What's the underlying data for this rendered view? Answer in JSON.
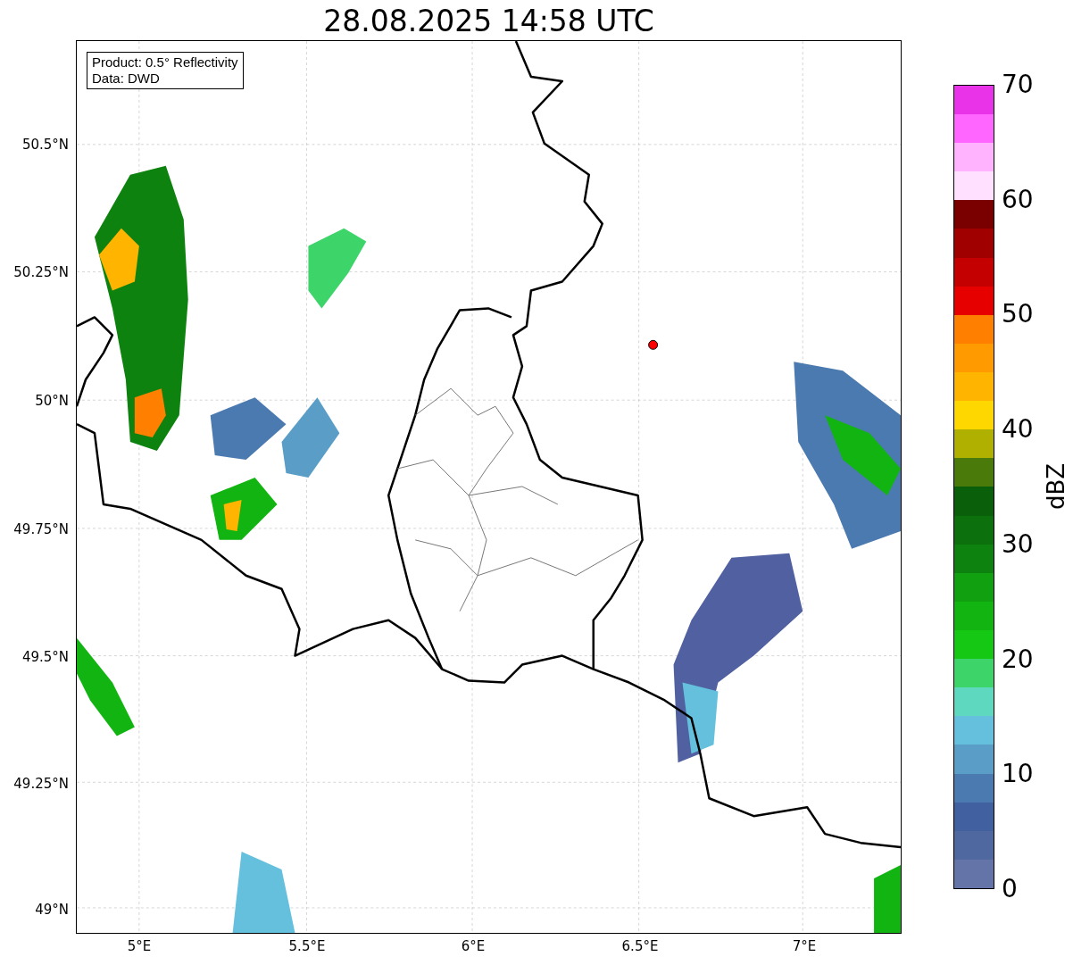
{
  "title": "28.08.2025 14:58 UTC",
  "info_box": {
    "lines": [
      "Product: 0.5° Reflectivity",
      "Data: DWD"
    ]
  },
  "map": {
    "y_ticks": [
      "50.5°N",
      "50.25°N",
      "50°N",
      "49.75°N",
      "49.5°N",
      "49.25°N",
      "49°N"
    ],
    "x_ticks": [
      "5°E",
      "5.5°E",
      "6°E",
      "6.5°E",
      "7°E"
    ]
  },
  "colorbar": {
    "label": "dBZ",
    "ticks": [
      "70",
      "60",
      "50",
      "40",
      "30",
      "20",
      "10",
      "0"
    ]
  }
}
